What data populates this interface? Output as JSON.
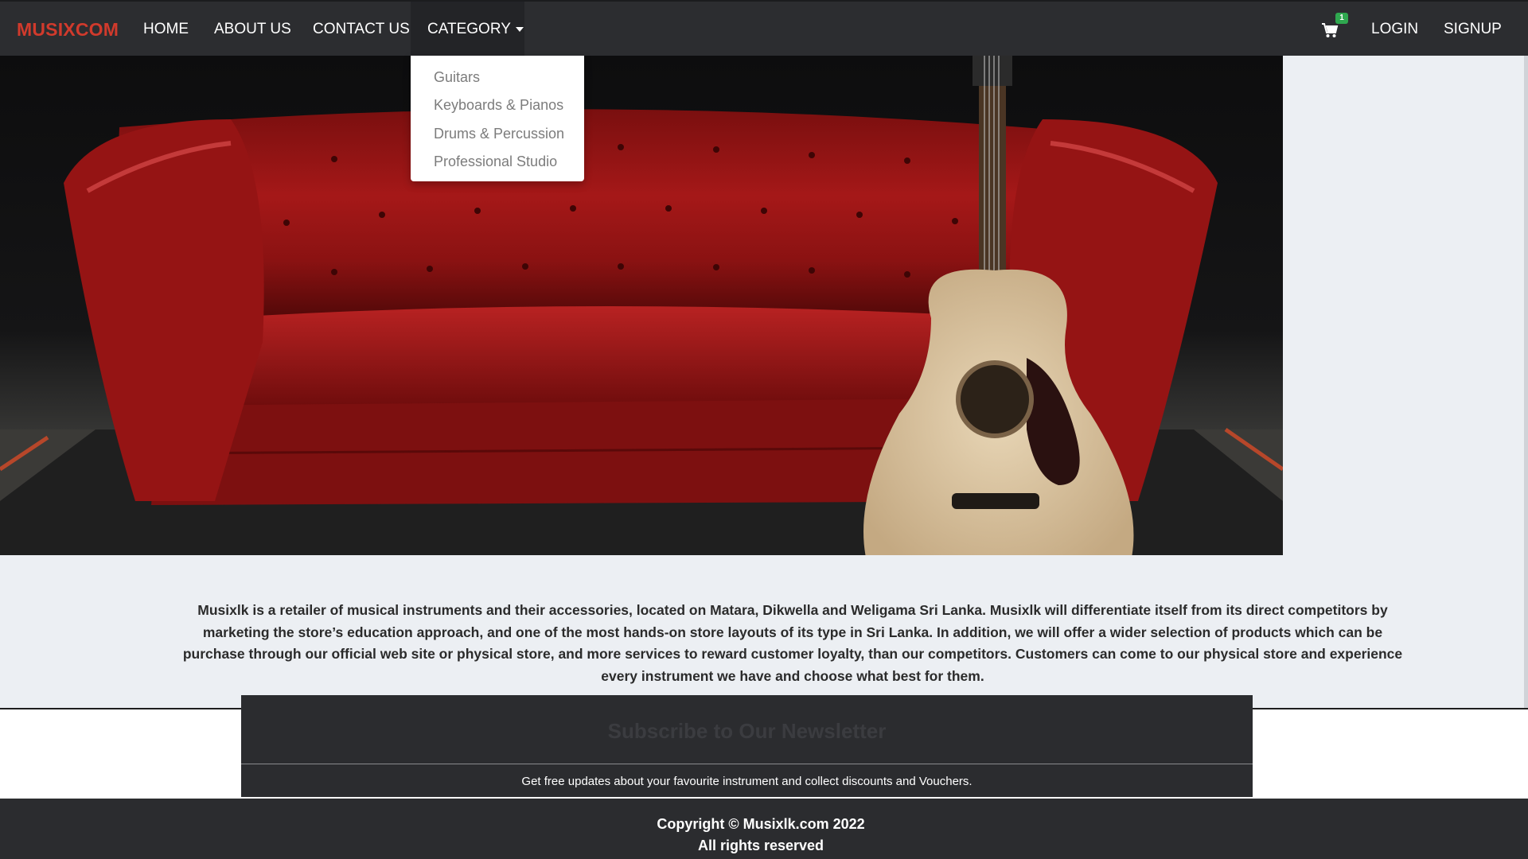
{
  "navbar": {
    "brand": "MUSIXCOM",
    "links": {
      "home": "HOME",
      "about": "ABOUT US",
      "contact": "CONTACT US",
      "category": "CATEGORY"
    },
    "cart_count": "1",
    "login": "LOGIN",
    "signup": "SIGNUP",
    "icons": {
      "cart": "shopping-cart-icon",
      "caret": "caret-down-icon"
    }
  },
  "category_dropdown": {
    "items": [
      "Guitars",
      "Keyboards & Pianos",
      "Drums & Percussion",
      "Professional Studio"
    ]
  },
  "carousel": {
    "slide_count": 5,
    "active_index": 0
  },
  "about": {
    "text": "Musixlk is a retailer of musical instruments and their accessories, located on Matara, Dikwella and Weligama Sri Lanka. Musixlk will differentiate itself from its direct competitors by marketing the store’s education approach, and one of the most hands-on store layouts of its type in Sri Lanka. In addition, we will offer a wider selection of products which can be purchase through our official web site or physical store, and more services to reward customer loyalty, than our competitors. Customers can come to our physical store and experience every instrument we have and choose what best for them."
  },
  "newsletter": {
    "title": "Subscribe to Our Newsletter",
    "subtitle": "Get free updates about your favourite instrument and collect discounts and Vouchers."
  },
  "footer": {
    "copyright": "Copyright © Musixlk.com 2022",
    "rights": "All rights reserved"
  },
  "colors": {
    "brand": "#d13a2c",
    "navbar": "#2c2d30",
    "page_bg": "#eceff3",
    "footer": "#2b2c2f",
    "badge": "#2fa84f"
  }
}
